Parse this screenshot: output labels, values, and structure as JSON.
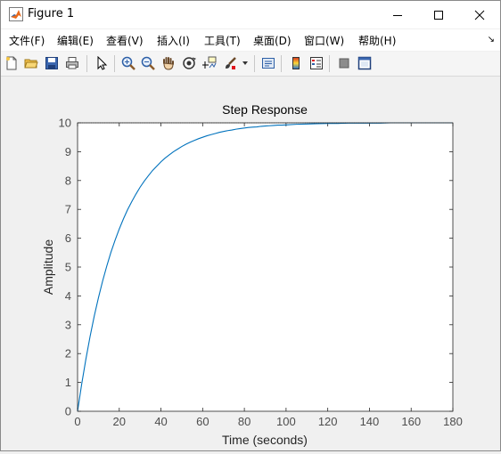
{
  "window": {
    "title": "Figure 1"
  },
  "menu": [
    "文件(F)",
    "编辑(E)",
    "查看(V)",
    "插入(I)",
    "工具(T)",
    "桌面(D)",
    "窗口(W)",
    "帮助(H)"
  ],
  "chart_data": {
    "type": "line",
    "title": "Step Response",
    "xlabel": "Time (seconds)",
    "ylabel": "Amplitude",
    "xlim": [
      0,
      180
    ],
    "ylim": [
      0,
      10
    ],
    "xticks": [
      0,
      20,
      40,
      60,
      80,
      100,
      120,
      140,
      160,
      180
    ],
    "yticks": [
      0,
      1,
      2,
      3,
      4,
      5,
      6,
      7,
      8,
      9,
      10
    ],
    "grid": false,
    "series": [
      {
        "color": "#0072bd",
        "x": [
          0,
          2,
          4,
          6,
          8,
          10,
          12,
          14,
          16,
          18,
          20,
          22,
          24,
          26,
          28,
          30,
          32,
          34,
          36,
          38,
          40,
          42,
          44,
          46,
          48,
          50,
          52,
          54,
          56,
          58,
          60,
          62,
          64,
          66,
          68,
          70,
          72,
          74,
          76,
          78,
          80,
          82,
          84,
          86,
          88,
          90,
          92,
          94,
          96,
          98,
          100,
          105,
          110,
          115,
          120,
          125,
          130,
          135,
          140,
          145,
          150,
          155,
          160,
          165,
          170,
          175,
          180
        ],
        "y": [
          0,
          0.95,
          1.81,
          2.59,
          3.3,
          3.93,
          4.51,
          5.03,
          5.51,
          5.93,
          6.32,
          6.67,
          6.99,
          7.27,
          7.53,
          7.77,
          7.98,
          8.17,
          8.35,
          8.5,
          8.65,
          8.78,
          8.89,
          9.0,
          9.09,
          9.18,
          9.26,
          9.33,
          9.39,
          9.45,
          9.5,
          9.55,
          9.59,
          9.63,
          9.67,
          9.7,
          9.73,
          9.75,
          9.78,
          9.8,
          9.82,
          9.84,
          9.85,
          9.86,
          9.88,
          9.89,
          9.9,
          9.91,
          9.92,
          9.92,
          9.93,
          9.95,
          9.96,
          9.97,
          9.98,
          9.98,
          9.99,
          9.99,
          9.99,
          9.99,
          10.0,
          10.0,
          10.0,
          10.0,
          10.0,
          10.0,
          10.0
        ]
      }
    ]
  }
}
